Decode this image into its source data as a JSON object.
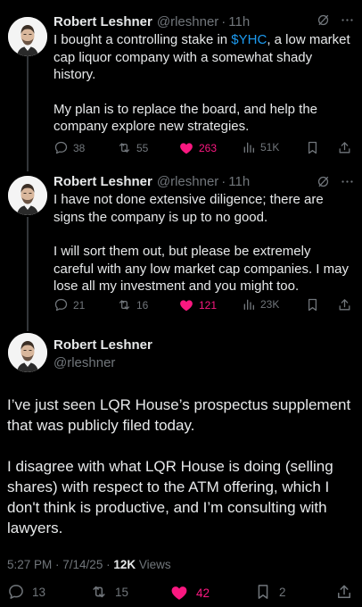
{
  "tweets": [
    {
      "name": "Robert Leshner",
      "handle": "@rleshner",
      "sep": "·",
      "time": "11h",
      "text_before_tag": "I bought a controlling stake in ",
      "cashtag": "$YHC",
      "text_after_tag": ", a low market cap liquor company with a somewhat shady history.",
      "para2": "My plan is to replace the board, and help the company explore new strategies.",
      "replies": "38",
      "reposts": "55",
      "likes": "263",
      "views": "51K"
    },
    {
      "name": "Robert Leshner",
      "handle": "@rleshner",
      "sep": "·",
      "time": "11h",
      "para1": "I have not done extensive diligence; there are signs the company is up to no good.",
      "para2": "I will sort them out, but please be extremely careful with any low market cap companies. I may lose all my investment and you might too.",
      "replies": "21",
      "reposts": "16",
      "likes": "121",
      "views": "23K"
    }
  ],
  "main_tweet": {
    "name": "Robert Leshner",
    "handle": "@rleshner",
    "para1": "I’ve just seen LQR House’s prospectus supplement that was publicly filed today.",
    "para2": "I disagree with what LQR House is doing (selling shares) with respect to the ATM offering, which I don't think is productive, and I’m consulting with lawyers.",
    "time": "5:27 PM",
    "date": "7/14/25",
    "sep": " · ",
    "views_count": "12K",
    "views_label": " Views",
    "replies": "13",
    "reposts": "15",
    "likes": "42",
    "bookmarks": "2"
  },
  "colors": {
    "background": "#000000",
    "text": "#e7e9ea",
    "muted": "#71767b",
    "link": "#1d9bf0",
    "like": "#f91880"
  },
  "icons": [
    "grok-icon",
    "more-icon",
    "reply-icon",
    "repost-icon",
    "like-filled-icon",
    "views-icon",
    "bookmark-icon",
    "share-icon"
  ]
}
